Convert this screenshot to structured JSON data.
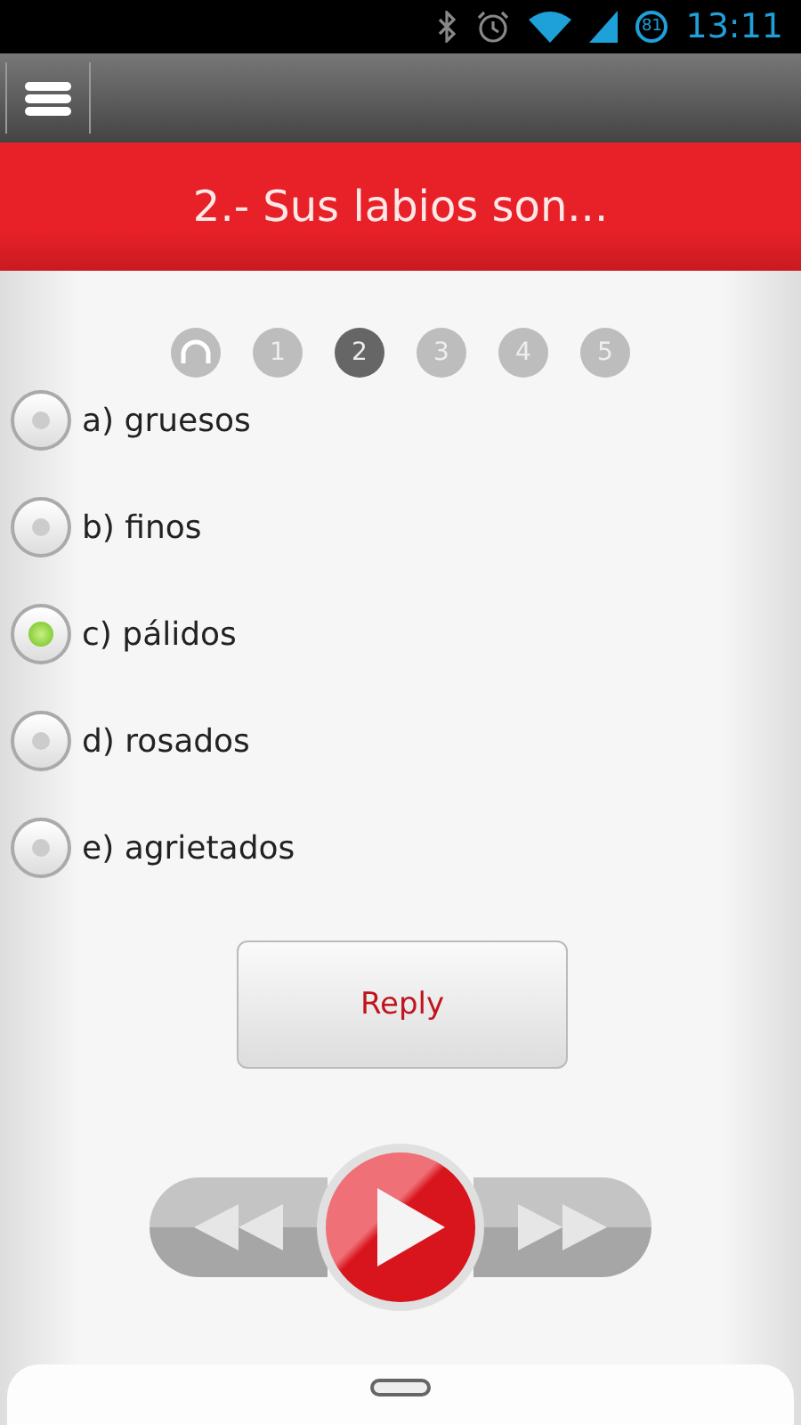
{
  "status_bar": {
    "battery": "81",
    "time": "13:11"
  },
  "question": {
    "title": "2.- Sus labios son..."
  },
  "audio_step": {
    "selected": false
  },
  "steps": [
    {
      "label": "1",
      "selected": false
    },
    {
      "label": "2",
      "selected": true
    },
    {
      "label": "3",
      "selected": false
    },
    {
      "label": "4",
      "selected": false
    },
    {
      "label": "5",
      "selected": false
    }
  ],
  "options": [
    {
      "label": "a) gruesos",
      "selected": false
    },
    {
      "label": "b) finos",
      "selected": false
    },
    {
      "label": "c) pálidos",
      "selected": true
    },
    {
      "label": "d) rosados",
      "selected": false
    },
    {
      "label": "e) agrietados",
      "selected": false
    }
  ],
  "reply_button": "Reply"
}
